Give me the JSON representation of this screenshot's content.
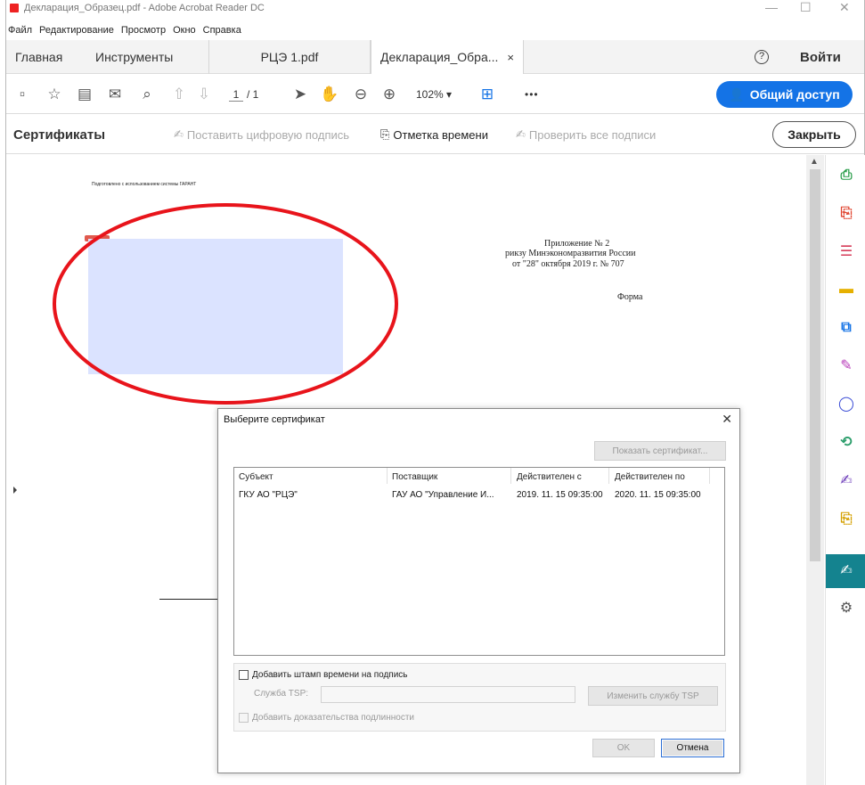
{
  "window": {
    "title": "Декларация_Образец.pdf - Adobe Acrobat Reader DC",
    "minimize": "—",
    "maximize": "☐",
    "close": "✕"
  },
  "menubar": [
    "Файл",
    "Редактирование",
    "Просмотр",
    "Окно",
    "Справка"
  ],
  "tabs": {
    "home": "Главная",
    "tools": "Инструменты",
    "doc1": "РЦЭ 1.pdf",
    "doc2": "Декларация_Обра...",
    "doc2_close": "×",
    "help": "?",
    "signin": "Войти"
  },
  "toolbar": {
    "page_current": "1",
    "page_total": "/ 1",
    "zoom": "102%",
    "more": "•••",
    "share_label": "Общий доступ"
  },
  "certbar": {
    "title": "Сертификаты",
    "digital_sign": "Поставить цифровую подпись",
    "timestamp": "Отметка времени",
    "verify_all": "Проверить все подписи",
    "close": "Закрыть"
  },
  "document": {
    "header_note": "Подготовлено с использованием системы ГАРАНТ",
    "appendix_line1": "Приложение № 2",
    "appendix_line2": "рикзу Минэкономразвития России",
    "appendix_line3": "от \"28\" октября 2019 г. № 707",
    "form_label": "Форма"
  },
  "dialog": {
    "title": "Выберите сертификат",
    "close": "✕",
    "show_cert": "Показать сертификат...",
    "columns": [
      "Субъект",
      "Поставщик",
      "Действителен с",
      "Действителен по"
    ],
    "rows": [
      {
        "subject": "ГКУ АО \"РЦЭ\"",
        "issuer": "ГАУ АО \"Управление И...",
        "valid_from": "2019. 11. 15 09:35:00",
        "valid_to": "2020. 11. 15 09:35:00"
      }
    ],
    "add_timestamp": "Добавить штамп времени на подпись",
    "tsp_service_label": "Служба TSP:",
    "tsp_service_value": "",
    "change_tsp": "Изменить службу TSP",
    "add_auth": "Добавить доказательства подлинности",
    "ok": "OK",
    "cancel": "Отмена"
  },
  "colors": {
    "accent": "#1473e6",
    "active_tool": "#14838f",
    "highlight_circle": "#e8141b",
    "redaction_fill": "#dbe3ff"
  }
}
